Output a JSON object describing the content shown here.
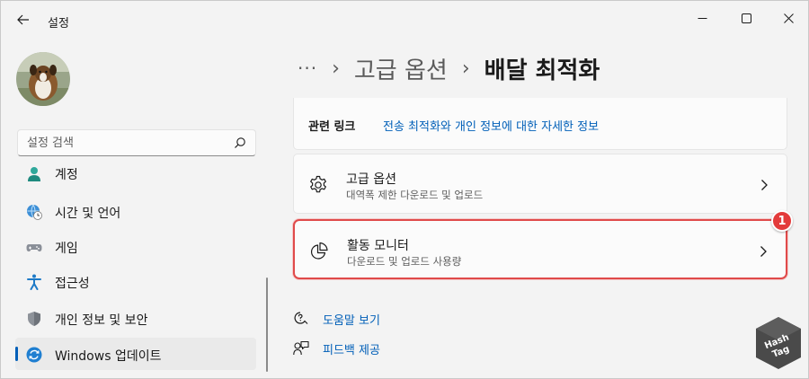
{
  "window": {
    "title": "설정",
    "controls": {
      "minimize": "minimize-icon",
      "maximize": "maximize-icon",
      "close": "close-icon"
    }
  },
  "sidebar": {
    "search": {
      "placeholder": "설정 검색"
    },
    "items": [
      {
        "label": "계정",
        "icon": "account-icon",
        "active": false
      },
      {
        "label": "시간 및 언어",
        "icon": "time-language-icon",
        "active": false
      },
      {
        "label": "게임",
        "icon": "gaming-icon",
        "active": false
      },
      {
        "label": "접근성",
        "icon": "accessibility-icon",
        "active": false
      },
      {
        "label": "개인 정보 및 보안",
        "icon": "shield-icon",
        "active": false
      },
      {
        "label": "Windows 업데이트",
        "icon": "windows-update-icon",
        "active": true
      }
    ]
  },
  "breadcrumb": {
    "more": "···",
    "separator": "›",
    "parent": "고급 옵션",
    "current": "배달 최적화"
  },
  "related": {
    "title": "관련 링크",
    "link": "전송 최적화와 개인 정보에 대한 자세한 정보"
  },
  "options": [
    {
      "title": "고급 옵션",
      "subtitle": "대역폭 제한 다운로드 및 업로드",
      "icon": "gear-icon"
    },
    {
      "title": "활동 모니터",
      "subtitle": "다운로드 및 업로드 사용량",
      "icon": "pie-chart-icon",
      "highlighted": true
    }
  ],
  "annotation": {
    "badge": "1"
  },
  "help": {
    "get_help": "도움말 보기",
    "feedback": "피드백 제공"
  },
  "watermark": {
    "line1": "Hash",
    "line2": "Tag"
  },
  "colors": {
    "accent": "#005fb8",
    "highlight": "#e04a4a",
    "background": "#f3f3f3",
    "card": "#fbfbfb"
  }
}
